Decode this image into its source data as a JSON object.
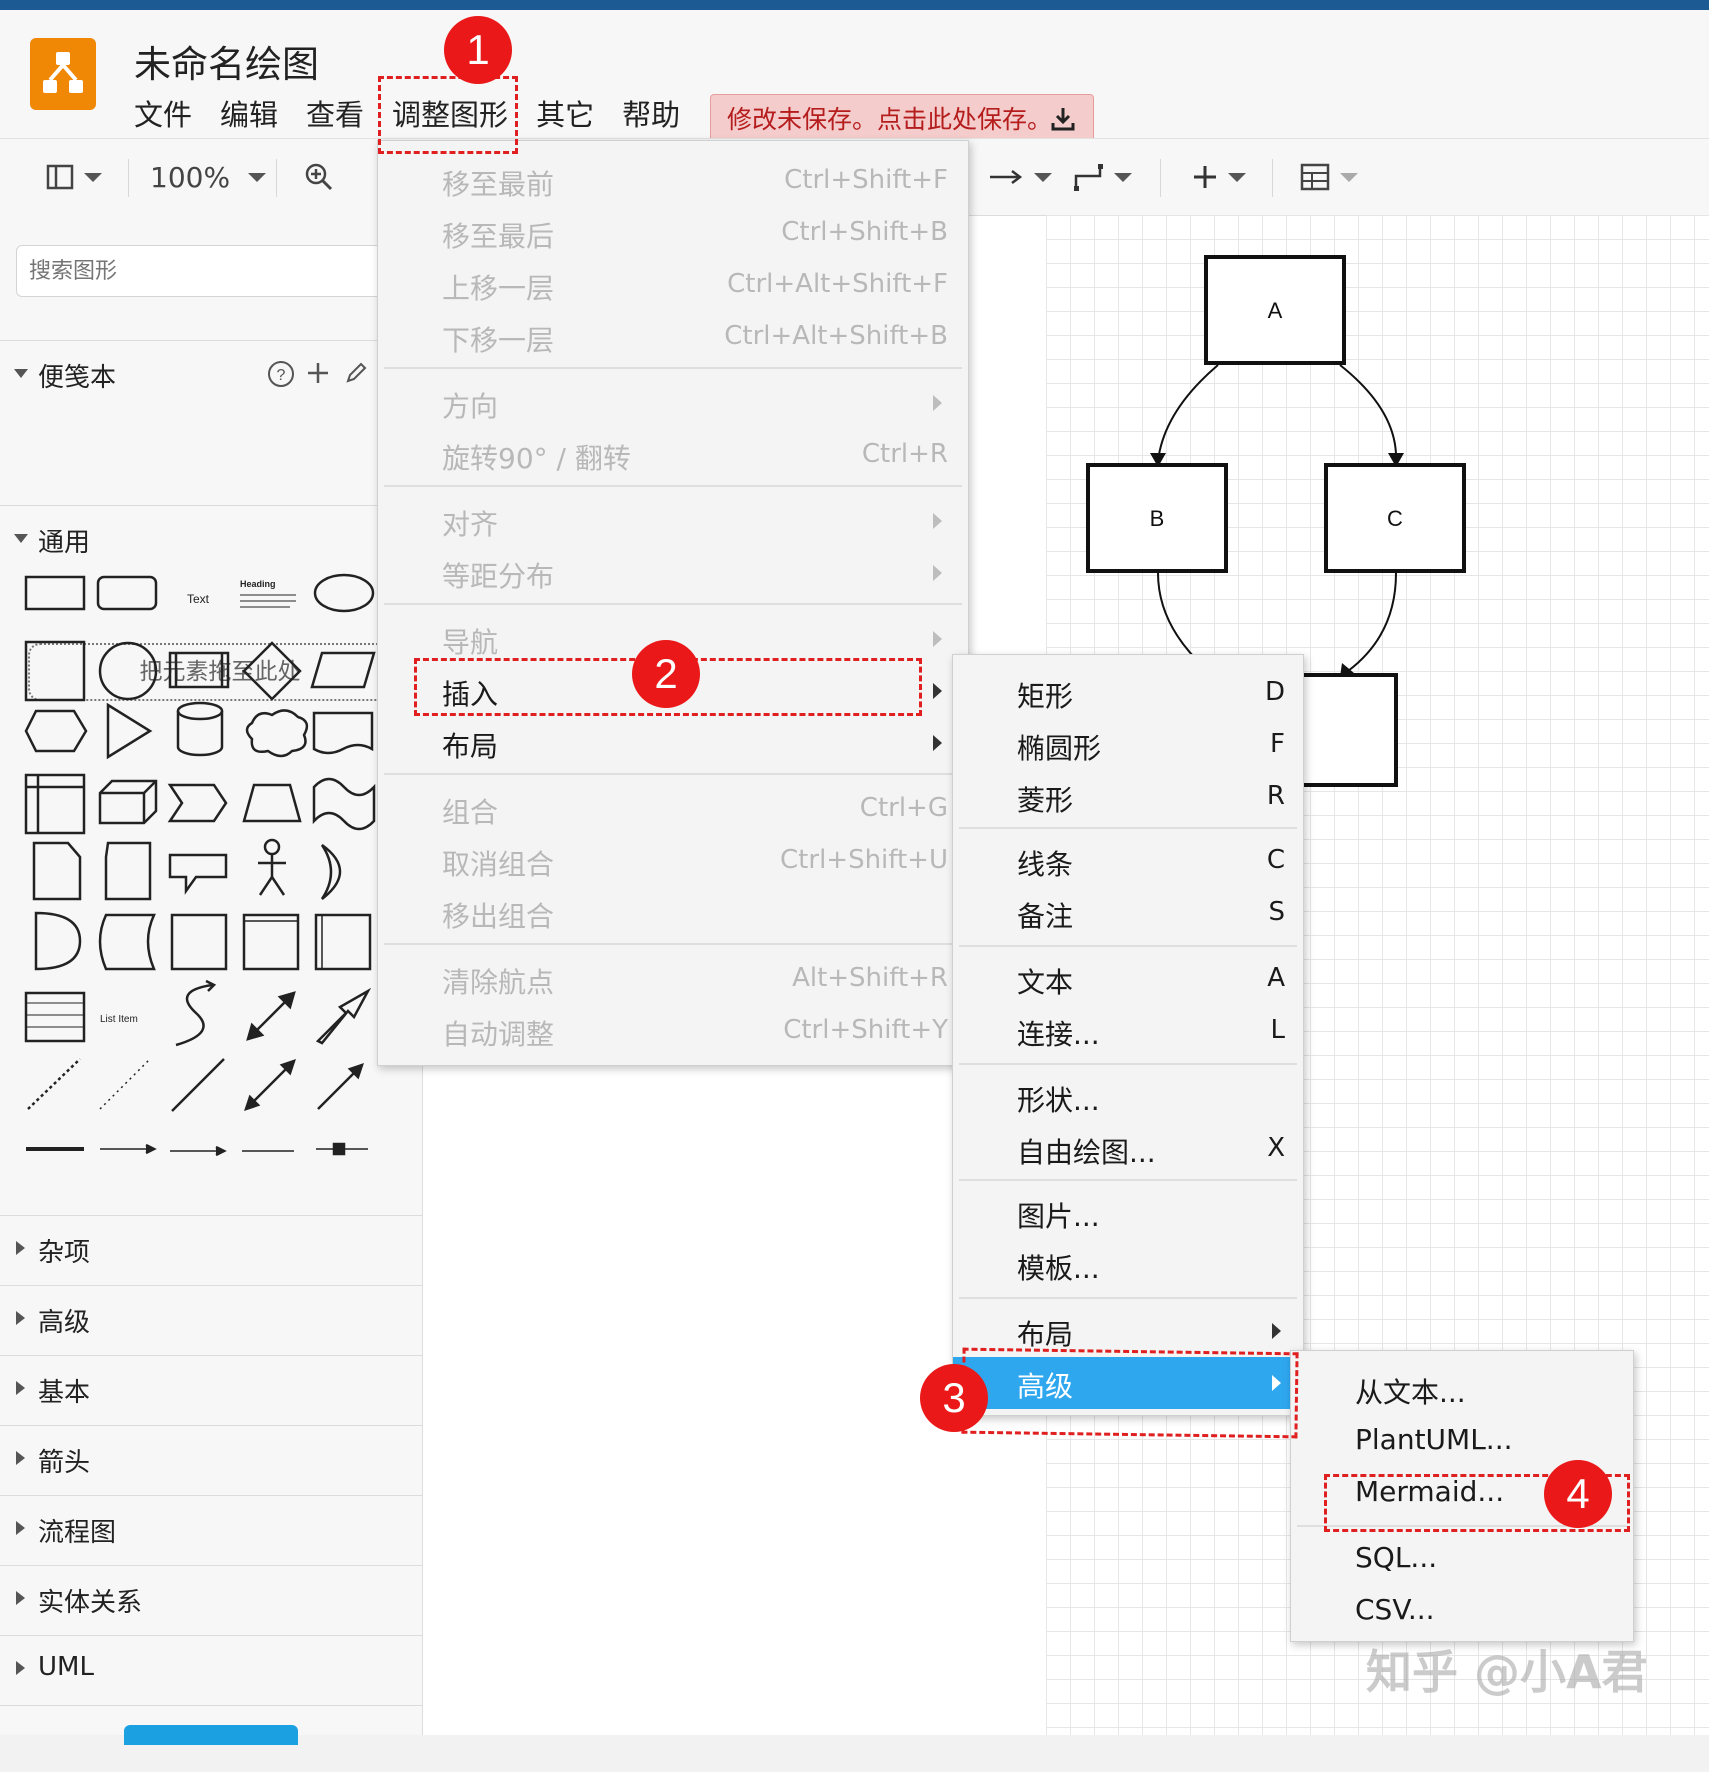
{
  "app": {
    "title": "未命名绘图"
  },
  "menubar": [
    "文件",
    "编辑",
    "查看",
    "调整图形",
    "其它",
    "帮助"
  ],
  "save_banner": "修改未保存。点击此处保存。",
  "toolbar": {
    "zoom": "100%"
  },
  "sidebar": {
    "search_placeholder": "搜索图形",
    "scratchpad": {
      "title": "便笺本",
      "drop_hint": "把元素拖至此处"
    },
    "general": "通用",
    "sections": [
      "杂项",
      "高级",
      "基本",
      "箭头",
      "流程图",
      "实体关系",
      "UML"
    ],
    "shape_text": {
      "text": "Text",
      "heading": "Heading",
      "list_item": "List Item"
    }
  },
  "arrange_menu": [
    {
      "label": "移至最前",
      "shortcut": "Ctrl+Shift+F"
    },
    {
      "label": "移至最后",
      "shortcut": "Ctrl+Shift+B"
    },
    {
      "label": "上移一层",
      "shortcut": "Ctrl+Alt+Shift+F"
    },
    {
      "label": "下移一层",
      "shortcut": "Ctrl+Alt+Shift+B"
    },
    {
      "label": "方向"
    },
    {
      "label": "旋转90° / 翻转",
      "shortcut": "Ctrl+R"
    },
    {
      "label": "对齐"
    },
    {
      "label": "等距分布"
    },
    {
      "label": "导航"
    },
    {
      "label": "插入"
    },
    {
      "label": "布局"
    },
    {
      "label": "组合",
      "shortcut": "Ctrl+G"
    },
    {
      "label": "取消组合",
      "shortcut": "Ctrl+Shift+U"
    },
    {
      "label": "移出组合"
    },
    {
      "label": "清除航点",
      "shortcut": "Alt+Shift+R"
    },
    {
      "label": "自动调整",
      "shortcut": "Ctrl+Shift+Y"
    }
  ],
  "insert_menu": [
    {
      "label": "矩形",
      "shortcut": "D"
    },
    {
      "label": "椭圆形",
      "shortcut": "F"
    },
    {
      "label": "菱形",
      "shortcut": "R"
    },
    {
      "label": "线条",
      "shortcut": "C"
    },
    {
      "label": "备注",
      "shortcut": "S"
    },
    {
      "label": "文本",
      "shortcut": "A"
    },
    {
      "label": "连接...",
      "shortcut": "L"
    },
    {
      "label": "形状..."
    },
    {
      "label": "自由绘图...",
      "shortcut": "X"
    },
    {
      "label": "图片..."
    },
    {
      "label": "模板..."
    },
    {
      "label": "布局"
    },
    {
      "label": "高级"
    }
  ],
  "advanced_menu": [
    "从文本...",
    "PlantUML...",
    "Mermaid...",
    "SQL...",
    "CSV..."
  ],
  "diagram": {
    "nodes": [
      "A",
      "B",
      "C"
    ]
  },
  "badges": [
    "1",
    "2",
    "3",
    "4"
  ],
  "watermark": "知乎 @小A君",
  "colors": {
    "highlight": "#2fa7ef",
    "annotation": "#e02020",
    "logo": "#f08705"
  }
}
